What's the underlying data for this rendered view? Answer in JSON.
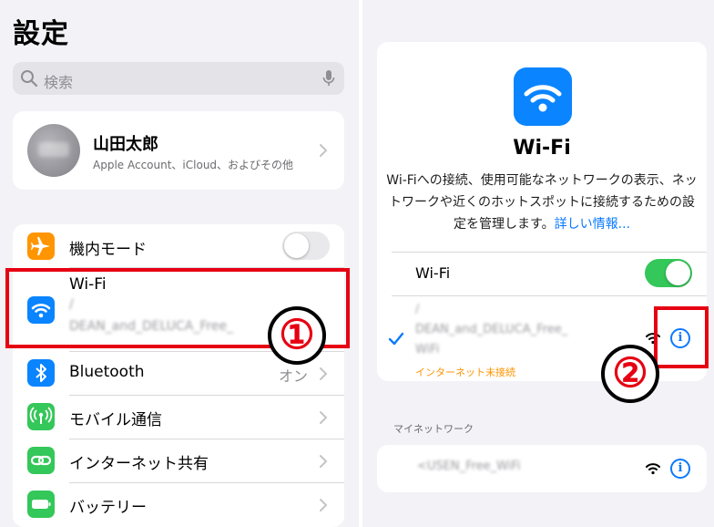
{
  "left": {
    "title": "設定",
    "search": {
      "placeholder": "検索"
    },
    "account": {
      "name": "山田太郎",
      "subtitle": "Apple Account、iCloud、およびその他"
    },
    "items": [
      {
        "label": "機内モード",
        "icon": "airplane-icon",
        "color": "#ff9500",
        "toggle": false
      },
      {
        "label": "Wi-Fi",
        "icon": "wifi-icon",
        "color": "#0a84ff",
        "value_line1": "/",
        "value_line2": "DEAN_and_DELUCA_Free_"
      },
      {
        "label": "Bluetooth",
        "icon": "bluetooth-icon",
        "color": "#0a84ff",
        "value": "オン"
      },
      {
        "label": "モバイル通信",
        "icon": "antenna-icon",
        "color": "#34c759"
      },
      {
        "label": "インターネット共有",
        "icon": "link-icon",
        "color": "#34c759"
      },
      {
        "label": "バッテリー",
        "icon": "battery-icon",
        "color": "#34c759"
      }
    ],
    "annotation": "①"
  },
  "right": {
    "title": "Wi-Fi",
    "description": "Wi-Fiへの接続、使用可能なネットワークの表示、ネットワークや近くのホットスポットに接続するための設定を管理します。",
    "link": "詳しい情報...",
    "wifi_toggle_label": "Wi-Fi",
    "wifi_on": true,
    "current_network": {
      "line1": "/",
      "line2": "DEAN_and_DELUCA_Free_",
      "line3": "WiFi",
      "status": "インターネット未接続"
    },
    "section_header": "マイネットワーク",
    "my_network": "<USEN_Free_WiFi",
    "annotation": "②"
  },
  "colors": {
    "accent": "#0a84ff",
    "green": "#34c759",
    "annotation_red": "#e60012",
    "warning": "#ff9500"
  }
}
